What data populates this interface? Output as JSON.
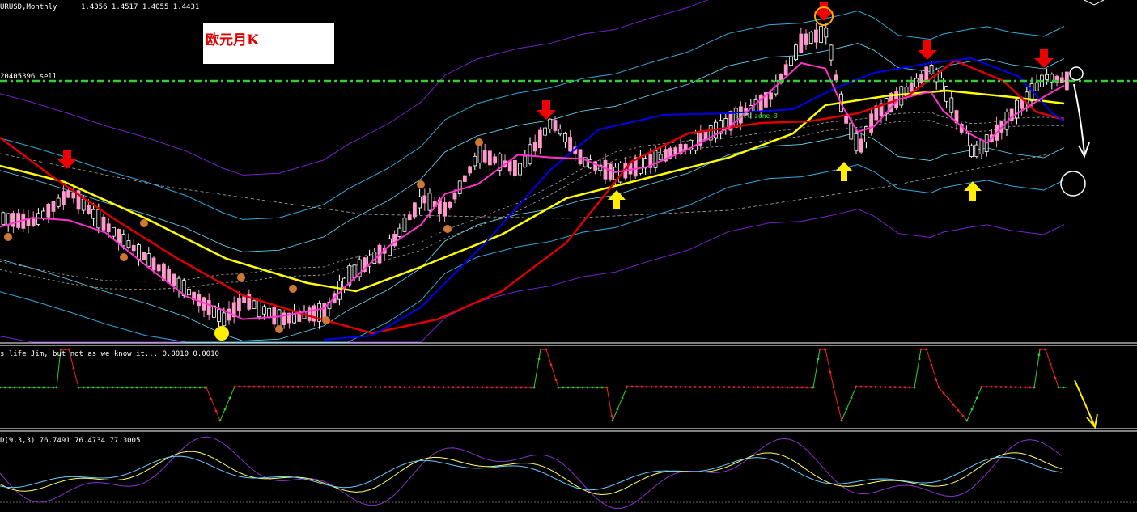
{
  "window": {
    "symbol_label": "URUSD,Monthly",
    "ohlc": "1.4356 1.4517 1.4055 1.4431"
  },
  "title_box": {
    "label": "欧元月K"
  },
  "order_line": {
    "label": "20405396 sell",
    "color": "#33cc33"
  },
  "main_panel": {
    "annotation": "Sell zone 3",
    "colors": {
      "bull_candle": "#ffffff",
      "bear_candle": "#ff99cc",
      "ma_yellow": "#ffff00",
      "ma_red": "#dd0000",
      "ma_blue": "#0000ee",
      "ma_magenta": "#ff33cc",
      "band_purple": "#7722cc",
      "band_blue": "#33aadd",
      "band_cyan": "#66ddff",
      "dashed_gray": "#aaaaaa",
      "signal_arrow_red": "#ee0000",
      "signal_arrow_yellow": "#ffee00"
    }
  },
  "indicator_1": {
    "label": "s life Jim, but not as we know it...  0.0010 0.0010",
    "up_color": "#33cc33",
    "down_color": "#ee2222"
  },
  "indicator_2": {
    "label": "D(9,3,3) 76.7491 76.4734 77.3005",
    "main_color": "#8833cc",
    "signal_color": "#ffff66",
    "slow_color": "#66ccff"
  },
  "chart_data": {
    "type": "candlestick",
    "timeframe": "Monthly",
    "last_bar": {
      "open": 1.4356,
      "high": 1.4517,
      "low": 1.4055,
      "close": 1.4431
    },
    "order_value": "20405396",
    "order_side": "sell",
    "sell_arrow_count": 5,
    "buy_arrow_count": 4,
    "kdj_values": [
      76.7491,
      76.4734,
      77.3005
    ],
    "indicator_1_values": [
      0.001,
      0.001
    ]
  }
}
